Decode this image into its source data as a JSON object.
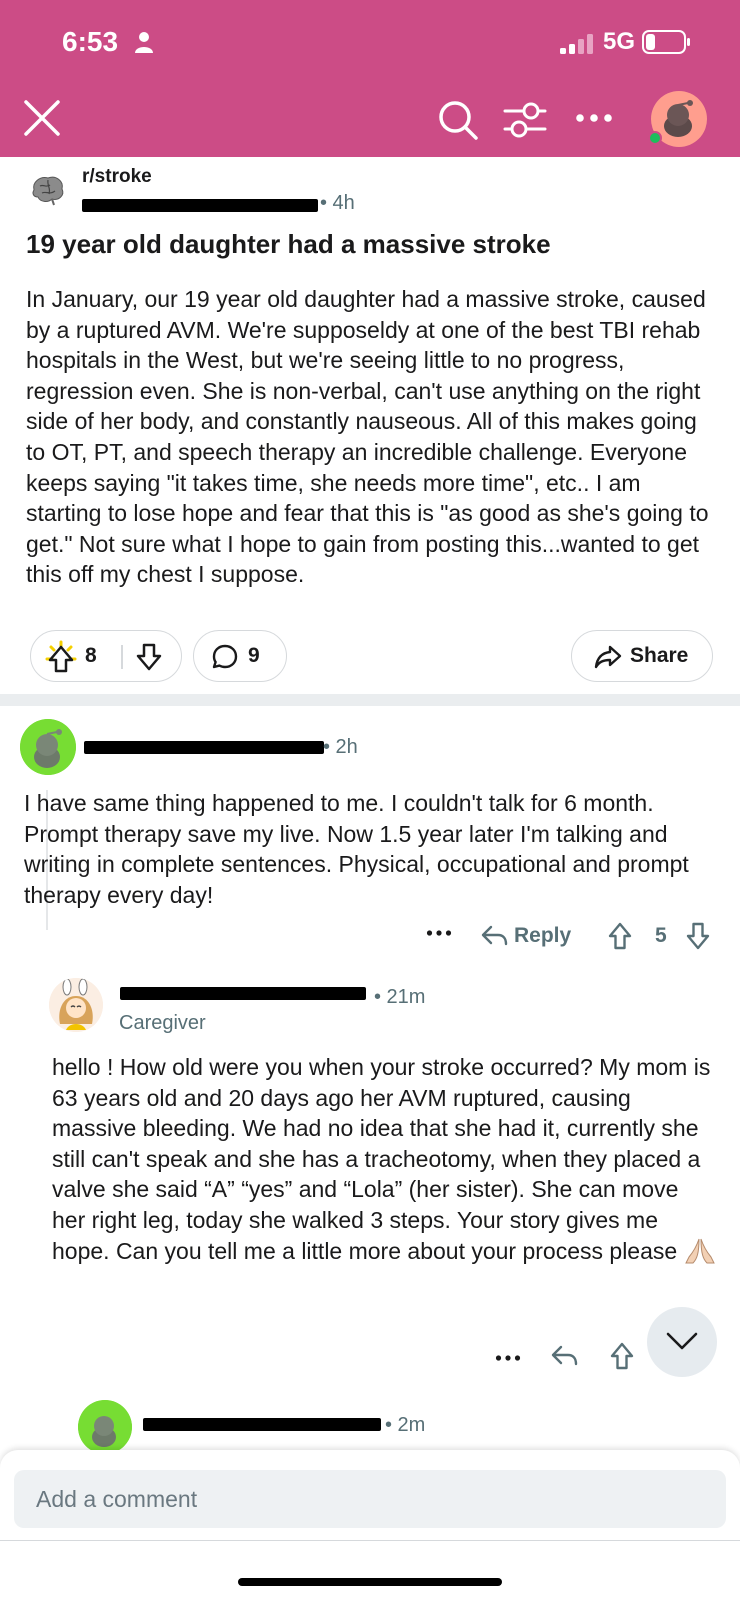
{
  "status_bar": {
    "time": "6:53",
    "network": "5G"
  },
  "post": {
    "subreddit": "r/stroke",
    "time": "• 4h",
    "title": "19 year old daughter had a massive stroke",
    "body": "In January, our 19 year old daughter had a massive stroke, caused by a ruptured AVM. We're supposeldy at one of the best TBI rehab hospitals in the West, but we're seeing little to no progress, regression even. She is non-verbal, can't use anything on the right side of her body, and constantly nauseous. All of this makes going to OT, PT, and speech therapy an incredible challenge. Everyone keeps saying \"it takes time, she needs more time\", etc.. I am starting to lose hope and fear that this is \"as good as she's going to get.\" Not sure what I hope to gain from posting this...wanted to get this off my chest I suppose.",
    "vote_count": "8",
    "comment_count": "9",
    "share_label": "Share"
  },
  "comments": [
    {
      "time": "• 2h",
      "body": "I have same thing happened to me. I couldn't talk for 6 month. Prompt therapy save my live. Now 1.5 year later I'm talking and writing in complete sentences. Physical, occupational and prompt therapy every day!",
      "reply_label": "Reply",
      "score": "5"
    },
    {
      "time": "• 21m",
      "flair": "Caregiver",
      "body": "hello ! How old were you when your stroke occurred? My mom is 63 years old and 20 days ago her AVM ruptured, causing massive bleeding. We had no idea that she had it, currently she still can't speak and she has a tracheotomy, when they placed a valve she said “A” “yes” and “Lola” (her sister). She can move her right leg, today she walked 3 steps. Your story gives me hope. Can you tell me a little more about your process please"
    },
    {
      "time": "• 2m"
    }
  ],
  "composer": {
    "placeholder": "Add a comment"
  },
  "colors": {
    "header": "#cc4c86",
    "online": "#1ebd5c",
    "avatar_green": "#77dd33"
  }
}
